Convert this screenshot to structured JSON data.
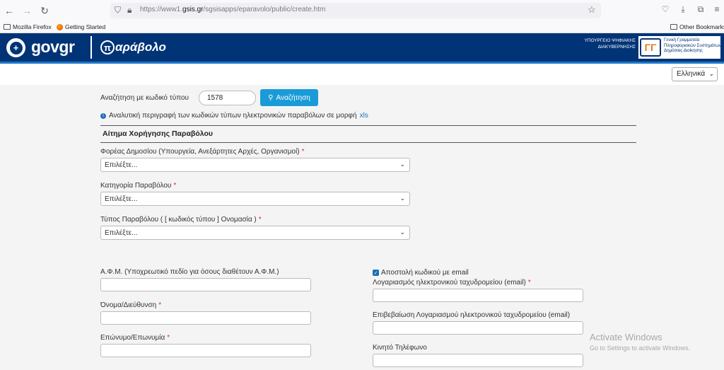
{
  "browser": {
    "url_prefix": "https://www1.",
    "url_domain": "gsis.gr",
    "url_path": "/sgsisapps/eparavolo/public/create.htm",
    "bookmarks": [
      "Mozilla Firefox",
      "Getting Started"
    ],
    "other_bookmarks": "Other Bookmarks"
  },
  "header": {
    "gov": "gov",
    "gr": "gr",
    "app_pi": "π",
    "app_name": "αράβολο",
    "ministry_text": "ΥΠΟΥΡΓΕΙΟ ΨΗΦΙΑΚΗΣ ΔΙΑΚΥΒΕΡΝΗΣΗΣ",
    "gsis_text": "Γενική Γραμματεία Πληροφοριακών Συστημάτων Δημόσιας Διοίκησης"
  },
  "language": {
    "selected": "Ελληνικά"
  },
  "search": {
    "label": "Αναζήτηση με κωδικό τύπου",
    "value": "1578",
    "button": "Αναζήτηση"
  },
  "info": {
    "text": "Αναλυτική περιγραφή των κωδικών τύπων ηλεκτρονικών παραβόλων σε μορφή",
    "link": "xls"
  },
  "form": {
    "section_title": "Αίτημα Χορήγησης Παραβόλου",
    "fields": {
      "agency": {
        "label": "Φορέας Δημοσίου (Υπουργεία, Ανεξάρτητες Αρχές, Οργανισμοί)",
        "value": "Επιλέξτε..."
      },
      "category": {
        "label": "Κατηγορία Παραβόλου",
        "value": "Επιλέξτε..."
      },
      "type": {
        "label": "Τύπος Παραβόλου ( [ κωδικός τύπου ] Ονομασία )",
        "value": "Επιλέξτε..."
      },
      "afm": {
        "label": "Α.Φ.Μ. (Υποχρεωτικό πεδίο για όσους διαθέτουν Α.Φ.Μ.)"
      },
      "name": {
        "label": "Όνομα/Διεύθυνση"
      },
      "surname": {
        "label": "Επώνυμο/Επωνυμία"
      },
      "send_email": {
        "label": "Αποστολή κωδικού με email",
        "checked": true
      },
      "email": {
        "label": "Λογαριασμός ηλεκτρονικού ταχυδρομείου (email)"
      },
      "email_confirm": {
        "label": "Επιβεβαίωση Λογαριασμού ηλεκτρονικού ταχυδρομείου (email)"
      },
      "mobile": {
        "label": "Κινητό Τηλέφωνο"
      }
    },
    "required_mark": "*"
  },
  "watermark": {
    "title": "Activate Windows",
    "subtitle": "Go to Settings to activate Windows."
  }
}
